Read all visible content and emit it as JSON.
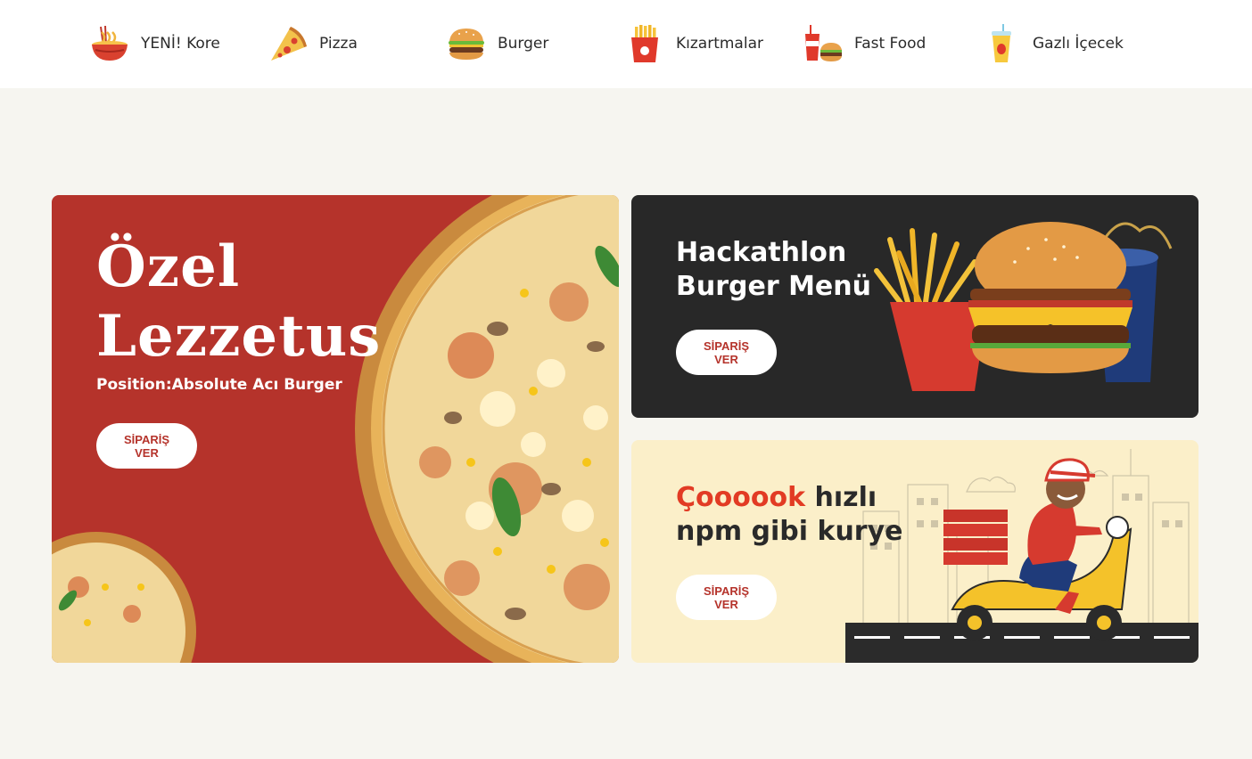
{
  "categories": [
    {
      "label": "YENİ! Kore",
      "icon": "noodle-bowl-icon"
    },
    {
      "label": "Pizza",
      "icon": "pizza-slice-icon"
    },
    {
      "label": "Burger",
      "icon": "burger-icon"
    },
    {
      "label": "Kızartmalar",
      "icon": "fries-icon"
    },
    {
      "label": "Fast Food",
      "icon": "fast-food-icon"
    },
    {
      "label": "Gazlı İçecek",
      "icon": "soda-cup-icon"
    }
  ],
  "promo_main": {
    "title_line1": "Özel",
    "title_line2": "Lezzetus",
    "subtitle": "Position:Absolute Acı Burger",
    "button": "SİPARİŞ VER"
  },
  "promo_burger": {
    "title_line1": "Hackathlon",
    "title_line2": "Burger Menü",
    "button": "SİPARİŞ VER"
  },
  "promo_courier": {
    "title_accent": "Çoooook",
    "title_rest": " hızlı",
    "title_line2": "npm gibi kurye",
    "button": "SİPARİŞ VER"
  },
  "colors": {
    "brand_red": "#b5332b",
    "accent_red": "#e23b24",
    "dark_card": "#282828",
    "cream_card": "#fbefc9",
    "page_bg": "#f6f5f0"
  }
}
